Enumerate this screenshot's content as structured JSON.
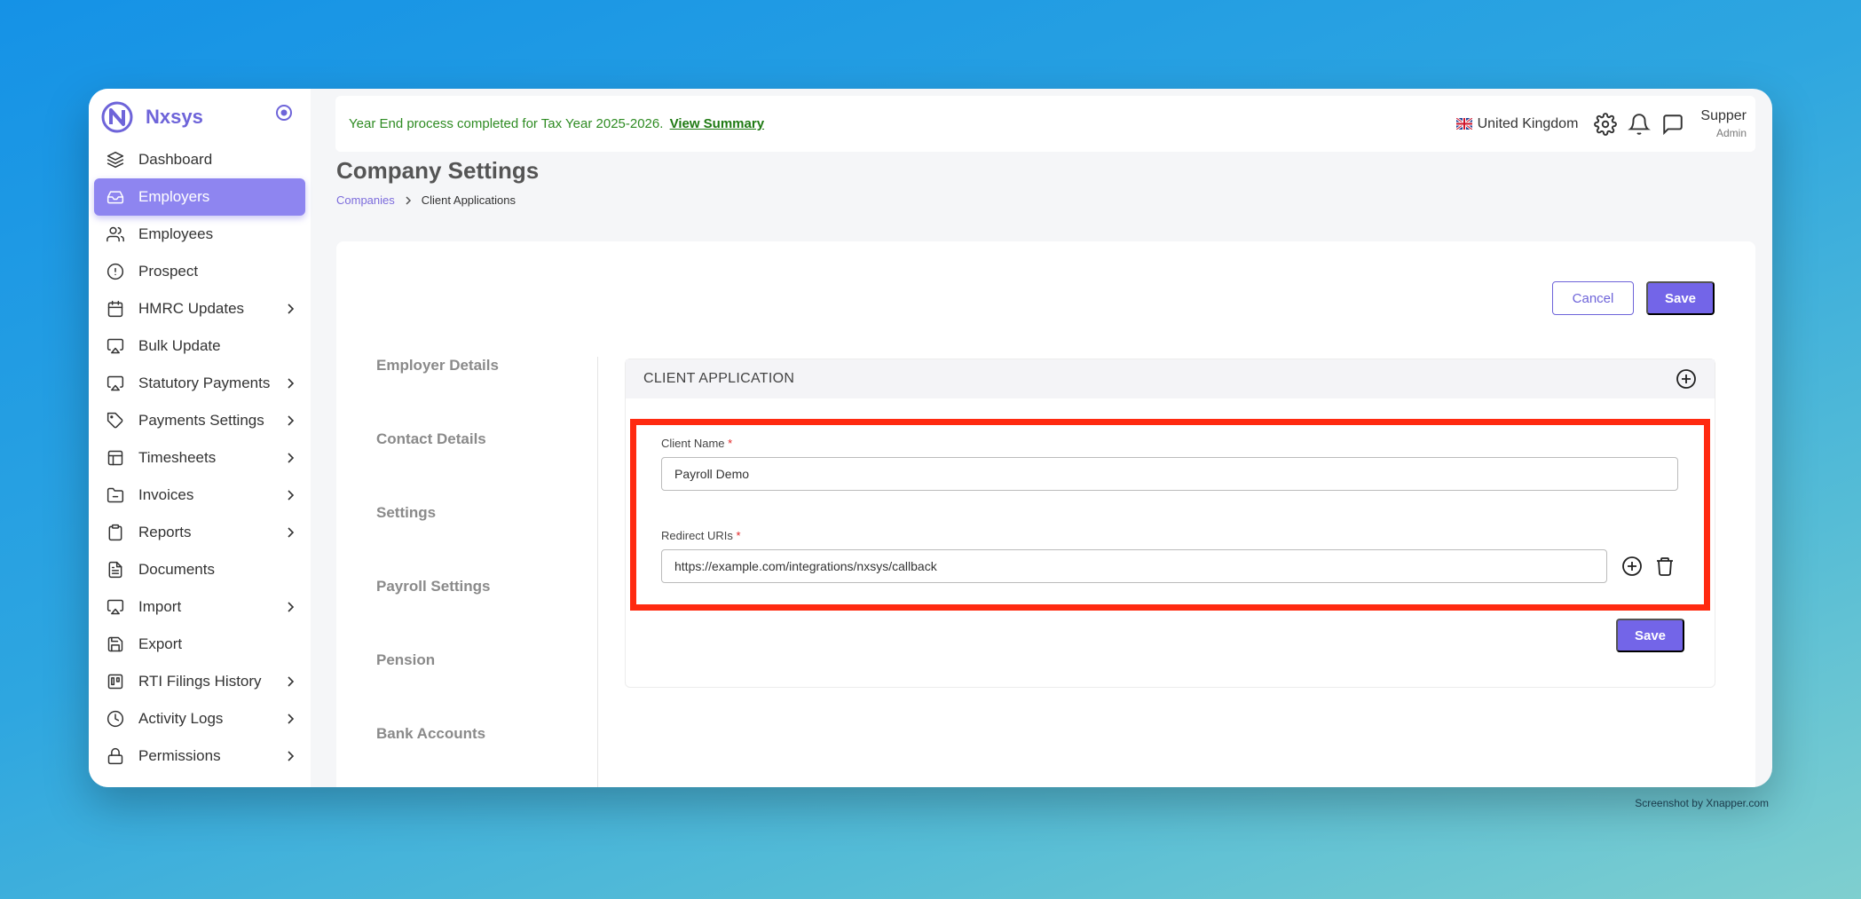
{
  "brand": {
    "name": "Nxsys"
  },
  "sidebar": {
    "items": [
      {
        "label": "Dashboard",
        "icon": "layers-icon",
        "chevron": false,
        "active": false
      },
      {
        "label": "Employers",
        "icon": "inbox-icon",
        "chevron": false,
        "active": true
      },
      {
        "label": "Employees",
        "icon": "users-icon",
        "chevron": false,
        "active": false
      },
      {
        "label": "Prospect",
        "icon": "alert-circle-icon",
        "chevron": false,
        "active": false
      },
      {
        "label": "HMRC Updates",
        "icon": "calendar-icon",
        "chevron": true,
        "active": false
      },
      {
        "label": "Bulk Update",
        "icon": "airplay-icon",
        "chevron": false,
        "active": false
      },
      {
        "label": "Statutory Payments",
        "icon": "airplay-icon",
        "chevron": true,
        "active": false
      },
      {
        "label": "Payments Settings",
        "icon": "tag-icon",
        "chevron": true,
        "active": false
      },
      {
        "label": "Timesheets",
        "icon": "table-icon",
        "chevron": true,
        "active": false
      },
      {
        "label": "Invoices",
        "icon": "folder-minus-icon",
        "chevron": true,
        "active": false
      },
      {
        "label": "Reports",
        "icon": "clipboard-icon",
        "chevron": true,
        "active": false
      },
      {
        "label": "Documents",
        "icon": "file-text-icon",
        "chevron": false,
        "active": false
      },
      {
        "label": "Import",
        "icon": "airplay-icon",
        "chevron": true,
        "active": false
      },
      {
        "label": "Export",
        "icon": "save-icon",
        "chevron": false,
        "active": false
      },
      {
        "label": "RTI Filings History",
        "icon": "trello-icon",
        "chevron": true,
        "active": false
      },
      {
        "label": "Activity Logs",
        "icon": "clock-icon",
        "chevron": true,
        "active": false
      },
      {
        "label": "Permissions",
        "icon": "lock-icon",
        "chevron": true,
        "active": false
      }
    ]
  },
  "topbar": {
    "notice_text": "Year End process completed for Tax Year 2025-2026.",
    "notice_link": "View Summary",
    "country": "United Kingdom",
    "user_name": "Supper",
    "user_role": "Admin"
  },
  "header": {
    "title": "Company Settings",
    "breadcrumb_link": "Companies",
    "breadcrumb_current": "Client Applications"
  },
  "actions": {
    "cancel": "Cancel",
    "save": "Save"
  },
  "left_menu": [
    "Employer Details",
    "Contact Details",
    "Settings",
    "Payroll Settings",
    "Pension",
    "Bank Accounts"
  ],
  "client_app": {
    "heading": "CLIENT APPLICATION",
    "client_name_label": "Client Name",
    "client_name_value": "Payroll Demo",
    "redirect_label": "Redirect URIs",
    "redirect_value": "https://example.com/integrations/nxsys/callback",
    "required_mark": "*",
    "save": "Save"
  },
  "colors": {
    "accent": "#7365e8",
    "highlight": "#ff2a10",
    "notice": "#2e8b22"
  },
  "watermark": "Screenshot by Xnapper.com"
}
